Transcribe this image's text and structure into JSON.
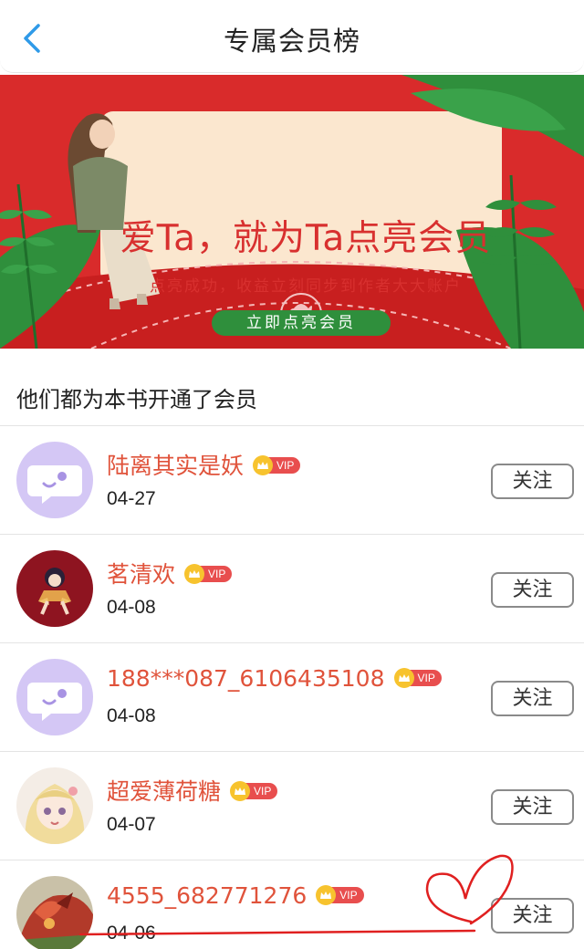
{
  "nav": {
    "title": "专属会员榜",
    "back_icon": "chevron-left-icon"
  },
  "banner": {
    "headline": "爱Ta，就为Ta点亮会员",
    "subtitle": "点亮成功，收益立刻同步到作者大大账户",
    "cta_label": "立即点亮会员",
    "colors": {
      "background": "#d92b2b",
      "card": "#fbe7cf",
      "leaf": "#2f8f3c",
      "cta": "#2f8f3c"
    }
  },
  "section_title": "他们都为本书开通了会员",
  "vip_label": "VIP",
  "follow_label": "关注",
  "members": [
    {
      "name": "陆离其实是妖",
      "date": "04-27",
      "avatar": "default-chat-avatar"
    },
    {
      "name": "茗清欢",
      "date": "04-08",
      "avatar": "anime-girl-dark-red-avatar"
    },
    {
      "name": "188***087_6106435108",
      "date": "04-08",
      "avatar": "default-chat-avatar"
    },
    {
      "name": "超爱薄荷糖",
      "date": "04-07",
      "avatar": "anime-girl-blonde-avatar"
    },
    {
      "name": "4555_682771276",
      "date": "04-06",
      "avatar": "red-dragon-avatar"
    }
  ],
  "colors": {
    "name": "#e0533b",
    "vip_badge": "#e84e4e",
    "crown": "#f7c32e",
    "back_icon": "#2f9ae8",
    "annotation": "#e02020"
  }
}
